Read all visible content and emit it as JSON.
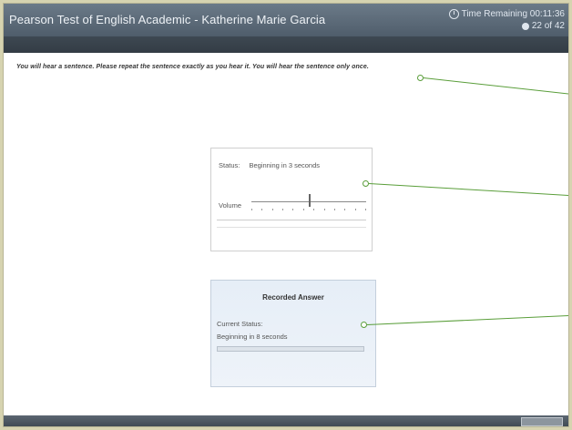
{
  "window": {
    "title": "Pearson Test of English Academic - Katherine Marie Garcia"
  },
  "timer": {
    "label": "Time Remaining 00:11:36",
    "progress": "22 of 42"
  },
  "instructions": "You will hear a sentence. Please repeat the sentence exactly as you hear it. You will hear the sentence only once.",
  "audio_player": {
    "status_label": "Status:",
    "status_value": "Beginning in 3 seconds",
    "volume_label": "Volume",
    "volume_level": 0.5
  },
  "recorder": {
    "title": "Recorded Answer",
    "current_status_label": "Current Status:",
    "current_status_value": "Beginning in 8 seconds",
    "progress": 0
  },
  "colors": {
    "callout": "#5a9e3a",
    "title_bar": "#5b6978"
  }
}
